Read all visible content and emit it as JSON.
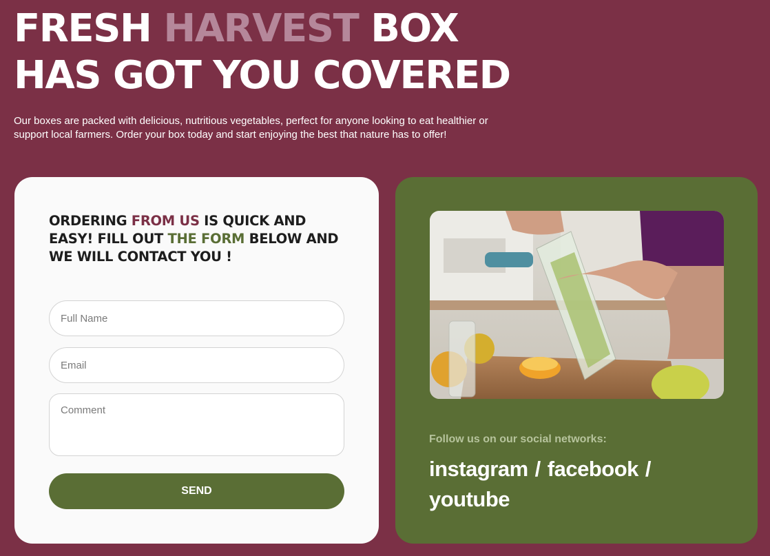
{
  "hero": {
    "title_part1": "FRESH ",
    "title_highlight": "HARVEST",
    "title_part2": " BOX",
    "title_line2": "HAS GOT YOU COVERED",
    "description": "Our boxes are packed with delicious, nutritious vegetables, perfect for anyone looking to eat healthier or support local farmers. Order your box today and start enjoying the best that nature has to offer!"
  },
  "form": {
    "heading_a": "ORDERING ",
    "heading_hl1": "FROM US",
    "heading_b": " IS QUICK AND EASY! FILL OUT ",
    "heading_hl2": "THE FORM",
    "heading_c": " BELOW AND WE WILL CONTACT YOU !",
    "name_placeholder": "Full Name",
    "email_placeholder": "Email",
    "comment_placeholder": "Comment",
    "send_label": "SEND"
  },
  "social": {
    "follow_text": "Follow us on our social networks:",
    "links": [
      "instagram",
      "facebook",
      "youtube"
    ],
    "separator": "/"
  },
  "colors": {
    "background": "#7b3046",
    "accent_green": "#5a6e35",
    "card_light": "#fafafa",
    "muted_pink": "#b5879a"
  }
}
